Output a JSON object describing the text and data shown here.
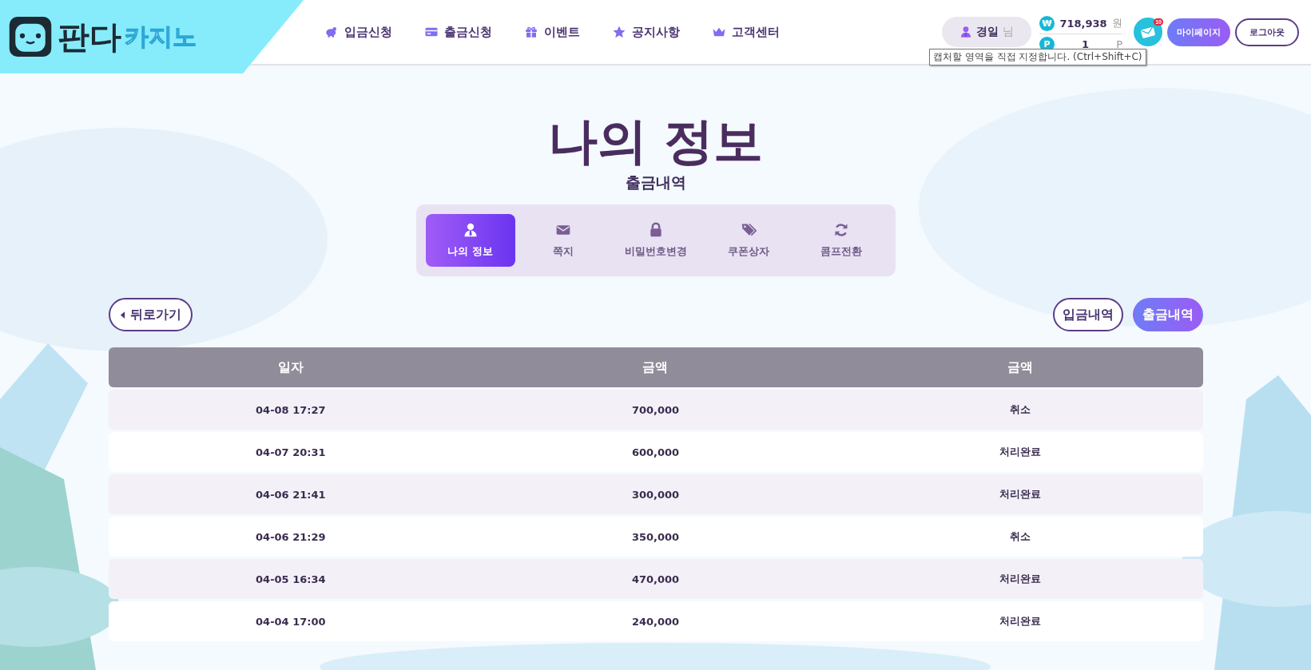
{
  "header": {
    "logo": {
      "main": "판다",
      "sub": "카지노"
    },
    "nav": [
      {
        "label": "입금신청"
      },
      {
        "label": "출금신청"
      },
      {
        "label": "이벤트"
      },
      {
        "label": "공지사항"
      },
      {
        "label": "고객센터"
      }
    ],
    "user": {
      "name": "경일",
      "suffix": "님"
    },
    "balance": {
      "money": "718,938",
      "money_unit": "원",
      "money_badge": "₩",
      "points": "1",
      "points_unit": "P",
      "points_badge": "P"
    },
    "messages_badge": "10",
    "buttons": [
      {
        "label": "마이페이지",
        "kind": "primary"
      },
      {
        "label": "로그아웃",
        "kind": "outline"
      }
    ],
    "tooltip": "캡처할 영역을 직접 지정합니다. (Ctrl+Shift+C)"
  },
  "page": {
    "title": "나의 정보",
    "subtitle": "출금내역"
  },
  "tabs": [
    {
      "label": "나의 정보",
      "selected": true
    },
    {
      "label": "쪽지",
      "selected": false
    },
    {
      "label": "비밀번호변경",
      "selected": false
    },
    {
      "label": "쿠폰상자",
      "selected": false
    },
    {
      "label": "콤프전환",
      "selected": false
    }
  ],
  "back_button": "뒤로가기",
  "history_tabs": [
    {
      "label": "입금내역",
      "selected": false
    },
    {
      "label": "출금내역",
      "selected": true
    }
  ],
  "table": {
    "columns": [
      "일자",
      "금액",
      "금액"
    ],
    "rows": [
      [
        "04-08 17:27",
        "700,000",
        "취소"
      ],
      [
        "04-07 20:31",
        "600,000",
        "처리완료"
      ],
      [
        "04-06 21:41",
        "300,000",
        "처리완료"
      ],
      [
        "04-06 21:29",
        "350,000",
        "취소"
      ],
      [
        "04-05 16:34",
        "470,000",
        "처리완료"
      ],
      [
        "04-04 17:00",
        "240,000",
        "처리완료"
      ]
    ]
  }
}
